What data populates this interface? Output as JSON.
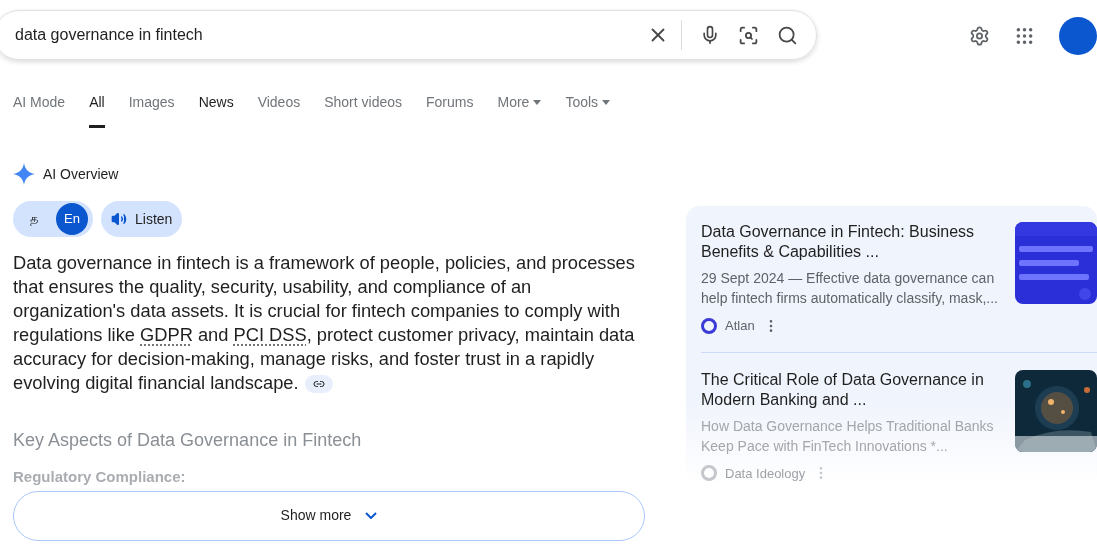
{
  "search": {
    "value": "data governance in fintech"
  },
  "tabs": [
    {
      "label": "AI Mode",
      "selected": false,
      "emphasis": false,
      "dropdown": false
    },
    {
      "label": "All",
      "selected": true,
      "dropdown": false
    },
    {
      "label": "Images",
      "selected": false,
      "emphasis": false,
      "dropdown": false
    },
    {
      "label": "News",
      "selected": false,
      "emphasis": true,
      "dropdown": false
    },
    {
      "label": "Videos",
      "selected": false,
      "emphasis": false,
      "dropdown": false
    },
    {
      "label": "Short videos",
      "selected": false,
      "emphasis": false,
      "dropdown": false
    },
    {
      "label": "Forums",
      "selected": false,
      "emphasis": false,
      "dropdown": false
    },
    {
      "label": "More",
      "selected": false,
      "emphasis": false,
      "dropdown": true
    },
    {
      "label": "Tools",
      "selected": false,
      "emphasis": false,
      "dropdown": true
    }
  ],
  "ai_overview": {
    "title": "AI Overview",
    "languages": [
      {
        "label": "த",
        "selected": false
      },
      {
        "label": "En",
        "selected": true
      }
    ],
    "listen": "Listen",
    "paragraph": [
      {
        "text": "Data governance in fintech is a framework of people, policies, and processes that ensures the quality, security, usability, and compliance of an organization's data assets. It is crucial for fintech companies to comply with regulations like ",
        "underlined": false
      },
      {
        "text": "GDPR",
        "underlined": true
      },
      {
        "text": " and ",
        "underlined": false
      },
      {
        "text": "PCI DSS",
        "underlined": true
      },
      {
        "text": ", protect customer privacy, maintain data accuracy for decision-making, manage risks, and foster trust in a rapidly evolving digital financial landscape.",
        "underlined": false
      }
    ],
    "heading": "Key Aspects of Data Governance in Fintech",
    "subheading": "Regulatory Compliance:",
    "show_more": "Show more"
  },
  "sources": [
    {
      "title": "Data Governance in Fintech: Business Benefits & Capabilities ...",
      "snippet": "29 Sept 2024 — Effective data governance can help fintech firms automatically classify, mask,...",
      "site": "Atlan",
      "faded": false
    },
    {
      "title": "The Critical Role of Data Governance in Modern Banking and ...",
      "snippet": "How Data Governance Helps Traditional Banks Keep Pace with FinTech Innovations *...",
      "site": "Data Ideology",
      "faded": true
    }
  ]
}
